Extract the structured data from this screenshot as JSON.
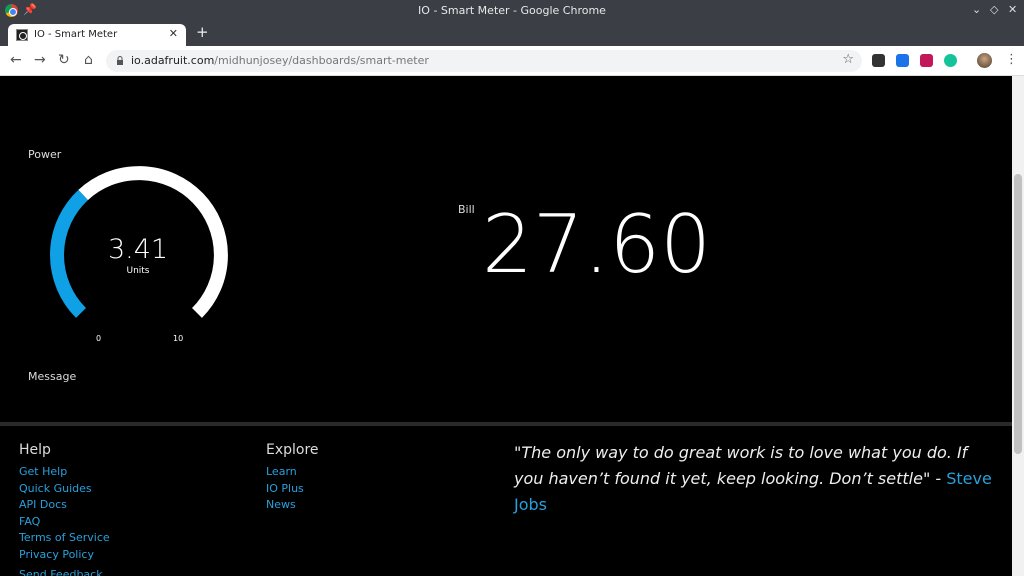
{
  "window": {
    "title": "IO - Smart Meter - Google Chrome"
  },
  "tab": {
    "title": "IO - Smart Meter",
    "close": "✕",
    "new": "+"
  },
  "address": {
    "host": "io.adafruit.com",
    "path": "/midhunjosey/dashboards/smart-meter"
  },
  "dashboard": {
    "power": {
      "title": "Power",
      "value": "3.41",
      "unit": "Units",
      "min": "0",
      "max": "10",
      "level": 0.341
    },
    "bill": {
      "title": "Bill",
      "value": "27.60"
    },
    "message": {
      "title": "Message"
    }
  },
  "footer": {
    "help": {
      "heading": "Help",
      "links": [
        "Get Help",
        "Quick Guides",
        "API Docs",
        "FAQ",
        "Terms of Service",
        "Privacy Policy",
        "Send Feedback"
      ]
    },
    "explore": {
      "heading": "Explore",
      "links": [
        "Learn",
        "IO Plus",
        "News"
      ]
    },
    "quote": {
      "text": "\"The only way to do great work is to love what you do. If you haven’t found it yet, keep looking. Don’t settle\" - ",
      "author": "Steve Jobs"
    }
  },
  "colors": {
    "accent": "#29a0dc",
    "gauge_fill": "#0fa0e6",
    "gauge_track": "#ffffff",
    "background": "#000000"
  },
  "icons": [
    "chrome-icon",
    "pin-icon",
    "back-icon",
    "forward-icon",
    "reload-icon",
    "lock-icon",
    "star-icon"
  ]
}
